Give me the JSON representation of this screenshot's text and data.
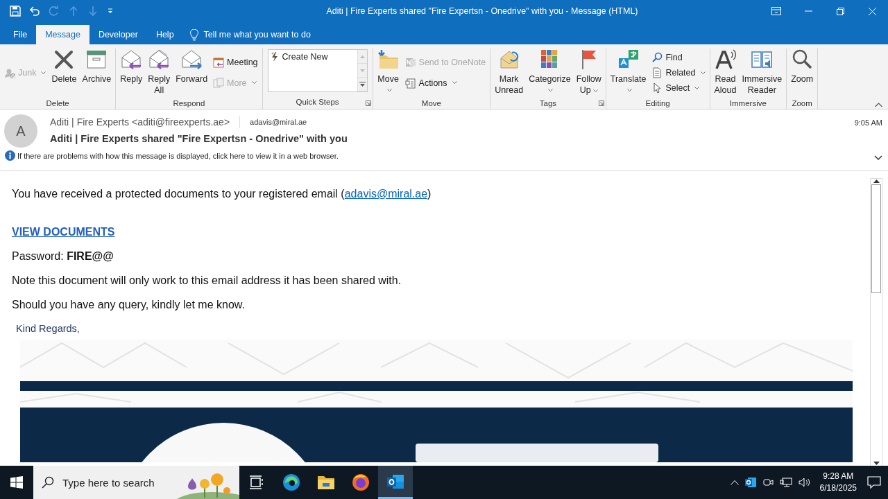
{
  "window": {
    "title": "Aditi | Fire Experts shared \"Fire Expertsn - Onedrive\" with you  -  Message (HTML)"
  },
  "tabs": [
    {
      "label": "File",
      "selected": false
    },
    {
      "label": "Message",
      "selected": true
    },
    {
      "label": "Developer",
      "selected": false
    },
    {
      "label": "Help",
      "selected": false
    }
  ],
  "tell_me": "Tell me what you want to do",
  "ribbon": {
    "groups": [
      {
        "label": "Delete",
        "launcher": false,
        "items": [
          {
            "kind": "stack",
            "items": [
              {
                "kind": "small",
                "label": "Junk",
                "disabled": true,
                "dropdown": true
              }
            ]
          },
          {
            "kind": "large",
            "label": "Delete",
            "disabled": false,
            "dropdown": false
          },
          {
            "kind": "large",
            "label": "Archive",
            "disabled": false,
            "dropdown": false
          }
        ]
      },
      {
        "label": "Respond",
        "launcher": false,
        "items": [
          {
            "kind": "large",
            "label": "Reply",
            "disabled": false,
            "dropdown": false
          },
          {
            "kind": "large",
            "label": "Reply\nAll",
            "disabled": false,
            "dropdown": false
          },
          {
            "kind": "large",
            "label": "Forward",
            "disabled": false,
            "dropdown": false
          },
          {
            "kind": "stack",
            "items": [
              {
                "kind": "small",
                "label": "Meeting",
                "disabled": false,
                "dropdown": false
              },
              {
                "kind": "small",
                "label": "More",
                "disabled": true,
                "dropdown": true
              }
            ]
          }
        ]
      },
      {
        "label": "Quick Steps",
        "launcher": true,
        "items": [
          {
            "kind": "gallery",
            "items": [
              "Create New"
            ]
          }
        ]
      },
      {
        "label": "Move",
        "launcher": false,
        "items": [
          {
            "kind": "large",
            "label": "Move",
            "disabled": false,
            "dropdown": true
          },
          {
            "kind": "stack",
            "items": [
              {
                "kind": "small",
                "label": "Send to OneNote",
                "disabled": true,
                "dropdown": false
              },
              {
                "kind": "small",
                "label": "Actions",
                "disabled": false,
                "dropdown": true
              }
            ]
          }
        ]
      },
      {
        "label": "Tags",
        "launcher": true,
        "items": [
          {
            "kind": "large",
            "label": "Mark\nUnread",
            "disabled": false,
            "dropdown": false
          },
          {
            "kind": "large",
            "label": "Categorize",
            "disabled": false,
            "dropdown": true
          },
          {
            "kind": "large",
            "label": "Follow\nUp",
            "disabled": false,
            "dropdown": true
          }
        ]
      },
      {
        "label": "Editing",
        "launcher": false,
        "items": [
          {
            "kind": "large",
            "label": "Translate",
            "disabled": false,
            "dropdown": true
          },
          {
            "kind": "stack",
            "items": [
              {
                "kind": "small",
                "label": "Find",
                "disabled": false,
                "dropdown": false
              },
              {
                "kind": "small",
                "label": "Related",
                "disabled": false,
                "dropdown": true
              },
              {
                "kind": "small",
                "label": "Select",
                "disabled": false,
                "dropdown": true
              }
            ]
          }
        ]
      },
      {
        "label": "Immersive",
        "launcher": false,
        "items": [
          {
            "kind": "large",
            "label": "Read\nAloud",
            "disabled": false,
            "dropdown": false
          },
          {
            "kind": "large",
            "label": "Immersive\nReader",
            "disabled": false,
            "dropdown": false
          }
        ]
      },
      {
        "label": "Zoom",
        "launcher": false,
        "items": [
          {
            "kind": "large",
            "label": "Zoom",
            "disabled": false,
            "dropdown": false
          }
        ]
      }
    ]
  },
  "message": {
    "avatar": "A",
    "from": "Aditi | Fire Experts <aditi@fireexperts.ae>",
    "to": "adavis@miral.ae",
    "time": "9:05 AM",
    "subject": "Aditi | Fire Experts shared \"Fire Expertsn - Onedrive\" with you",
    "info": "If there are problems with how this message is displayed, click here to view it in a web browser."
  },
  "body": [
    {
      "kind": "link_sentence",
      "before": "You have received a protected documents to your registered email (",
      "link": "adavis@miral.ae",
      "after": ")"
    },
    {
      "kind": "link",
      "text": "VIEW DOCUMENTS"
    },
    {
      "kind": "rich",
      "text": "Password: **FIRE@@**"
    },
    {
      "kind": "plain",
      "text": "Note this document will only work to this email address it has been shared with."
    },
    {
      "kind": "plain",
      "text": "Should you have any query, kindly let me know."
    },
    {
      "kind": "signoff",
      "text": "Kind Regards,"
    },
    {
      "kind": "picture"
    }
  ],
  "taskbar": {
    "search_placeholder": "Type here to search",
    "apps": [
      {
        "selected": false
      },
      {
        "selected": false
      },
      {
        "selected": false
      },
      {
        "selected": false
      },
      {
        "selected": true
      }
    ],
    "time": "9:28 AM",
    "date": "6/18/2025"
  }
}
